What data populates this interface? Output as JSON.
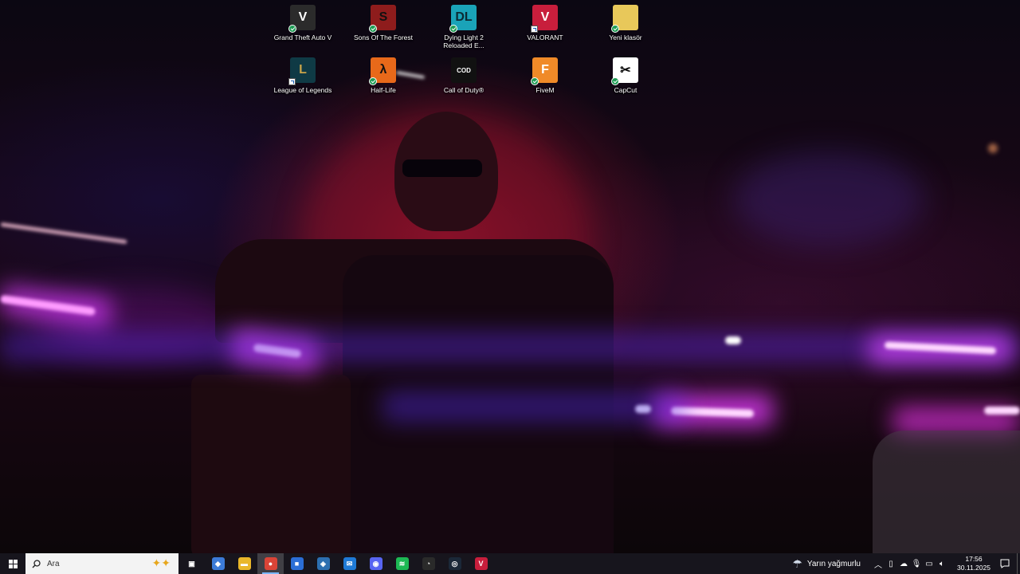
{
  "desktop": {
    "icons": [
      {
        "label": "Grand Theft Auto V",
        "glyph": "V",
        "bg": "#2b2b2b",
        "fg": "#ffffff",
        "badge": "sync"
      },
      {
        "label": "Sons Of The Forest",
        "glyph": "S",
        "bg": "#8e1c1c",
        "fg": "#111111",
        "badge": "sync"
      },
      {
        "label": "Dying Light 2 Reloaded E...",
        "glyph": "DL",
        "bg": "#1aa3b8",
        "fg": "#0b2a33",
        "badge": "sync"
      },
      {
        "label": "VALORANT",
        "glyph": "V",
        "bg": "#c81e3c",
        "fg": "#ffffff",
        "badge": "shortcut"
      },
      {
        "label": "Yeni klasör",
        "glyph": "",
        "bg": "#e8c85a",
        "fg": "#ffffff",
        "badge": "sync"
      },
      {
        "label": "League of Legends",
        "glyph": "L",
        "bg": "#0f3a45",
        "fg": "#c9a44a",
        "badge": "shortcut"
      },
      {
        "label": "Half-Life",
        "glyph": "λ",
        "bg": "#e8691a",
        "fg": "#111111",
        "badge": "sync"
      },
      {
        "label": "Call of Duty®",
        "glyph": "COD",
        "bg": "#111111",
        "fg": "#ffffff",
        "badge": "none"
      },
      {
        "label": "FiveM",
        "glyph": "F",
        "bg": "#f08a28",
        "fg": "#ffffff",
        "badge": "sync"
      },
      {
        "label": "CapCut",
        "glyph": "✂",
        "bg": "#ffffff",
        "fg": "#000000",
        "badge": "sync"
      }
    ]
  },
  "taskbar": {
    "search_placeholder": "Ara",
    "apps": [
      {
        "name": "task-view-icon",
        "glyph": "▣",
        "bg": "transparent"
      },
      {
        "name": "copilot-icon",
        "glyph": "◆",
        "bg": "#3c7bd8"
      },
      {
        "name": "file-explorer-icon",
        "glyph": "▬",
        "bg": "#e9b72a"
      },
      {
        "name": "chrome-icon",
        "glyph": "●",
        "bg": "#db4437",
        "active": true
      },
      {
        "name": "microsoft-store-icon",
        "glyph": "■",
        "bg": "#2b6ed6"
      },
      {
        "name": "network-app-icon",
        "glyph": "◈",
        "bg": "#2c6fb0"
      },
      {
        "name": "mail-icon",
        "glyph": "✉",
        "bg": "#1f7ad6"
      },
      {
        "name": "discord-icon",
        "glyph": "◉",
        "bg": "#5865f2"
      },
      {
        "name": "spotify-icon",
        "glyph": "≋",
        "bg": "#1db954"
      },
      {
        "name": "speed-app-icon",
        "glyph": "◔",
        "bg": "#2a2a2a"
      },
      {
        "name": "steam-icon",
        "glyph": "◎",
        "bg": "#1b2838"
      },
      {
        "name": "valorant-taskbar-icon",
        "glyph": "V",
        "bg": "#c81e3c"
      }
    ],
    "weather": "Yarın yağmurlu",
    "time": "17:56",
    "date": "30.11.2025"
  }
}
